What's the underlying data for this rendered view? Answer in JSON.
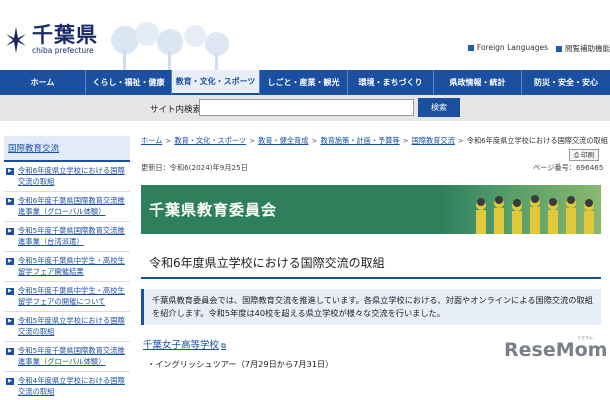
{
  "header": {
    "logo_title": "千葉県",
    "logo_subtitle": "chiba prefecture",
    "links": [
      "Foreign Languages",
      "閲覧補助機能"
    ]
  },
  "nav": {
    "items": [
      "ホーム",
      "くらし・福祉・健康",
      "教育・文化・スポーツ",
      "しごと・産業・観光",
      "環境・まちづくり",
      "県政情報・統計",
      "防災・安全・安心"
    ],
    "active_index": 2
  },
  "search": {
    "label": "サイト内検索",
    "value": "",
    "button_label": "検索"
  },
  "sidebar": {
    "heading": "国際教育交流",
    "items": [
      "令和6年度県立学校における国際交流の取組",
      "令和6年度千葉県国際教育交流推進事業（グローバル体験）",
      "令和5年度千葉県国際教育交流推進事業（台湾派遣）",
      "令和5年度千葉県中学生・高校生留学フェア開催結果",
      "令和5年度千葉県中学生・高校生留学フェアの開催について",
      "令和5年度県立学校における国際交流の取組",
      "令和5年度千葉県国際教育交流推進事業（グローバル体験）",
      "令和4年度県立学校における国際交流の取組"
    ]
  },
  "breadcrumb": {
    "items": [
      "ホーム",
      "教育・文化・スポーツ",
      "教育・健全育成",
      "教育施策・計画・予算等",
      "国際教育交流"
    ],
    "current": "令和6年度県立学校における国際交流の取組"
  },
  "meta": {
    "updated": "更新日：令和6(2024)年9月25日",
    "page_id": "ページ番号：696465",
    "print_label": "印刷"
  },
  "banner": {
    "title": "千葉県教育委員会"
  },
  "content": {
    "title": "令和6年度県立学校における国際交流の取組",
    "intro": "千葉県教育委員会では、国際教育交流を推進しています。各県立学校における、対面やオンラインによる国際交流の取組を紹介します。令和5年度は40校を超える県立学校が様々な交流を行いました。",
    "school": "千葉女子高等学校",
    "event": "イングリッシュツアー（7月29日から7月31日）"
  },
  "watermark": {
    "text": "ReseMom",
    "small": "リセマム"
  },
  "colors": {
    "nav": "#1b4fa0",
    "banner": "#2f7f5d",
    "link": "#1b4fa0"
  }
}
